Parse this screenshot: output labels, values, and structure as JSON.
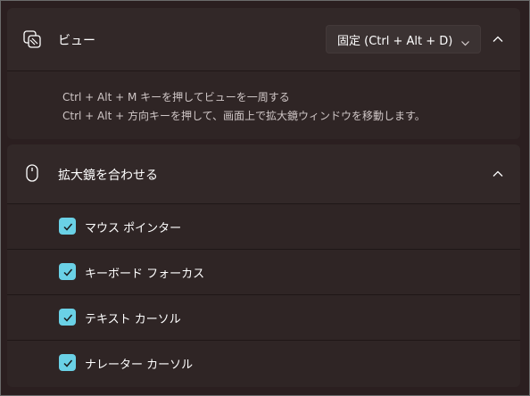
{
  "view_section": {
    "title": "ビュー",
    "dropdown_value": "固定 (Ctrl + Alt + D)",
    "description": [
      "Ctrl + Alt + M キーを押してビューを一周する",
      "Ctrl + Alt + 方向キーを押して、画面上で拡大鏡ウィンドウを移動します。"
    ]
  },
  "follow_section": {
    "title": "拡大鏡を合わせる",
    "options": [
      {
        "label": "マウス ポインター",
        "checked": true
      },
      {
        "label": "キーボード フォーカス",
        "checked": true
      },
      {
        "label": "テキスト カーソル",
        "checked": true
      },
      {
        "label": "ナレーター カーソル",
        "checked": true
      }
    ]
  },
  "colors": {
    "accent": "#6ad1e6",
    "card": "#322828",
    "background": "#2b1f20"
  }
}
